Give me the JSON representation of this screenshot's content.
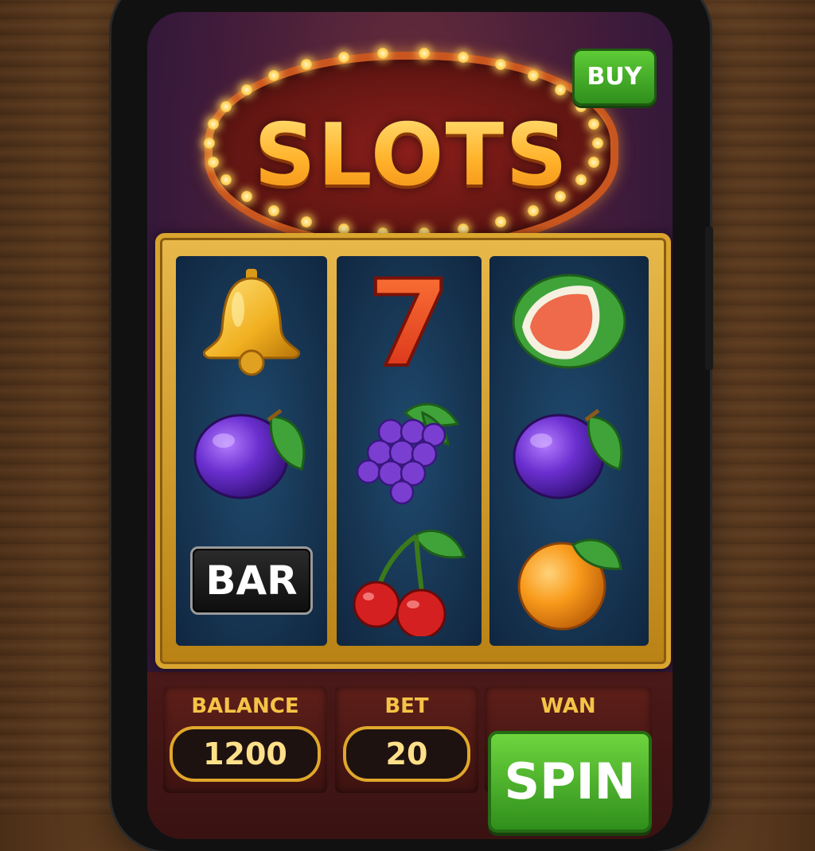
{
  "header": {
    "title": "SLOTS",
    "buy_label": "BUY"
  },
  "reels": [
    [
      "bell",
      "plum",
      "BAR"
    ],
    [
      "seven",
      "grapes",
      "cherries"
    ],
    [
      "watermelon",
      "plum",
      "orange"
    ]
  ],
  "symbols": {
    "seven_text": "7",
    "bar_text": "BAR"
  },
  "stats": {
    "balance_label": "BALANCE",
    "balance_value": "1200",
    "bet_label": "BET",
    "bet_value": "20",
    "win_label": "WAN"
  },
  "controls": {
    "spin_label": "SPIN"
  },
  "colors": {
    "accent_gold": "#e0a72a",
    "button_green": "#3fa824",
    "background_purple": "#4a1f3a"
  }
}
